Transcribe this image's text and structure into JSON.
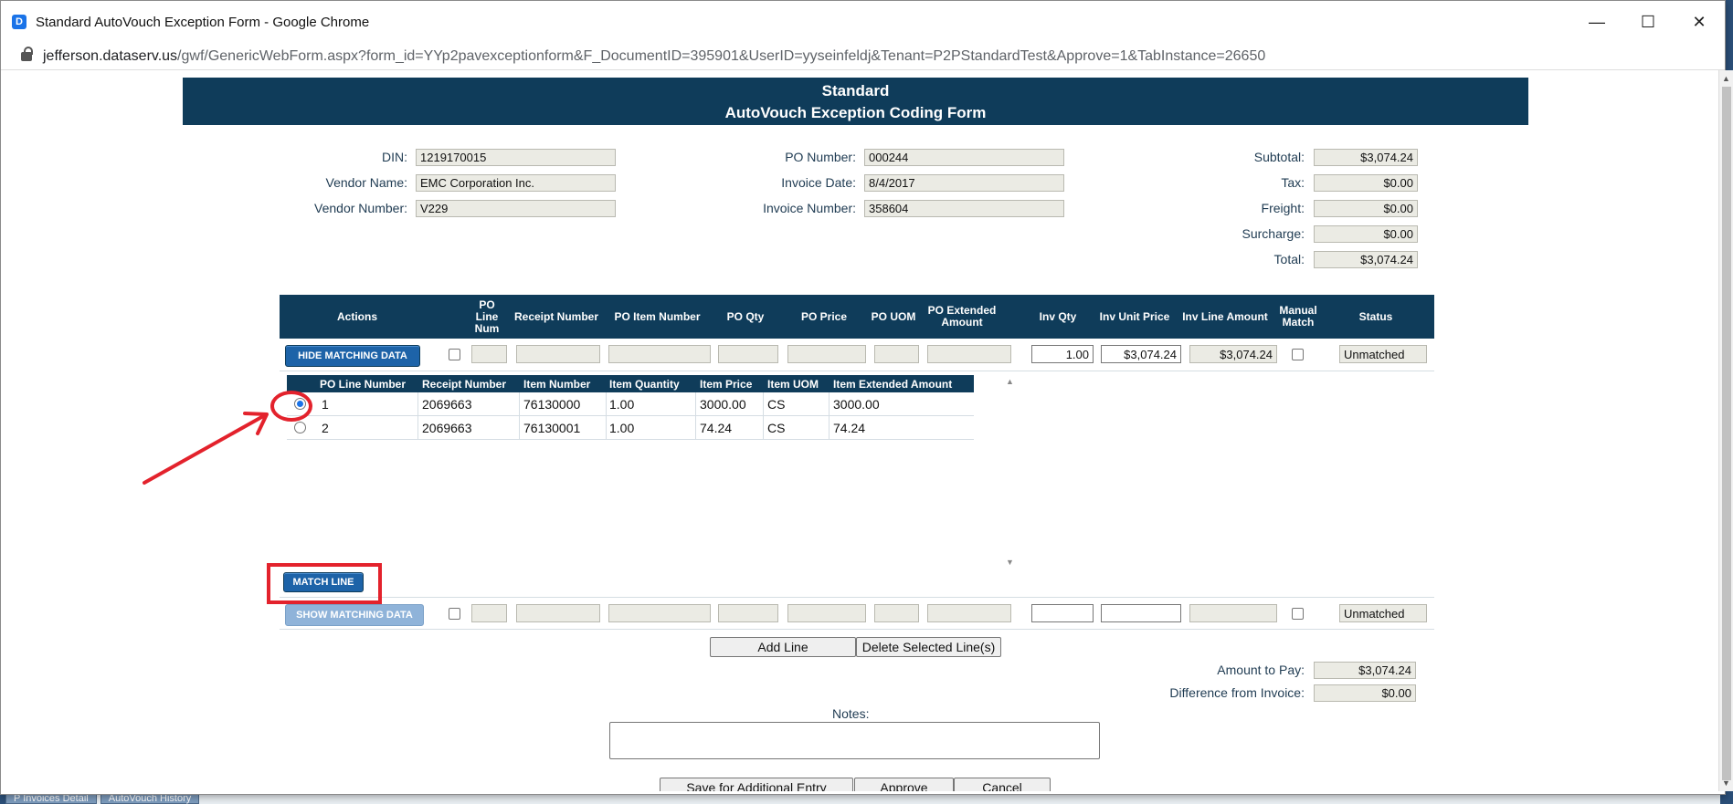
{
  "window": {
    "title": "Standard AutoVouch Exception Form - Google Chrome",
    "app_icon_letter": "D",
    "url_host": "jefferson.dataserv.us",
    "url_rest": "/gwf/GenericWebForm.aspx?form_id=YYp2pavexceptionform&F_DocumentID=395901&UserID=yyseinfeldj&Tenant=P2PStandardTest&Approve=1&TabInstance=26650",
    "minimize": "—",
    "maximize": "☐",
    "close": "✕"
  },
  "background_tabs": [
    "P Invoices Detail",
    "AutoVouch History"
  ],
  "form": {
    "title_line1": "Standard",
    "title_line2": "AutoVouch Exception Coding Form"
  },
  "header_fields": {
    "din_label": "DIN:",
    "din": "1219170015",
    "vendor_name_label": "Vendor Name:",
    "vendor_name": "EMC Corporation Inc.",
    "vendor_number_label": "Vendor Number:",
    "vendor_number": "V229",
    "po_number_label": "PO Number:",
    "po_number": "000244",
    "invoice_date_label": "Invoice Date:",
    "invoice_date": "8/4/2017",
    "invoice_number_label": "Invoice Number:",
    "invoice_number": "358604",
    "subtotal_label": "Subtotal:",
    "subtotal": "$3,074.24",
    "tax_label": "Tax:",
    "tax": "$0.00",
    "freight_label": "Freight:",
    "freight": "$0.00",
    "surcharge_label": "Surcharge:",
    "surcharge": "$0.00",
    "total_label": "Total:",
    "total": "$3,074.24"
  },
  "grid": {
    "headers": {
      "actions": "Actions",
      "po_line_num": "PO Line Num",
      "receipt_number": "Receipt Number",
      "po_item_number": "PO Item Number",
      "po_qty": "PO Qty",
      "po_price": "PO Price",
      "po_uom": "PO UOM",
      "po_extended_amount": "PO Extended Amount",
      "inv_qty": "Inv Qty",
      "inv_unit_price": "Inv Unit Price",
      "inv_line_amount": "Inv Line Amount",
      "manual_match": "Manual Match",
      "status": "Status"
    },
    "row1": {
      "action_label": "HIDE MATCHING DATA",
      "inv_qty": "1.00",
      "inv_unit_price": "$3,074.24",
      "inv_line_amount": "$3,074.24",
      "status": "Unmatched"
    },
    "row2": {
      "action_label": "SHOW MATCHING DATA",
      "inv_qty": "",
      "inv_unit_price": "",
      "inv_line_amount": "",
      "status": "Unmatched"
    }
  },
  "matching": {
    "headers": {
      "po_line_number": "PO Line Number",
      "receipt_number": "Receipt Number",
      "item_number": "Item Number",
      "item_quantity": "Item Quantity",
      "item_price": "Item Price",
      "item_uom": "Item UOM",
      "item_extended_amount": "Item Extended Amount"
    },
    "rows": [
      {
        "po_line_number": "1",
        "receipt_number": "2069663",
        "item_number": "76130000",
        "item_quantity": "1.00",
        "item_price": "3000.00",
        "item_uom": "CS",
        "item_extended_amount": "3000.00",
        "selected": true
      },
      {
        "po_line_number": "2",
        "receipt_number": "2069663",
        "item_number": "76130001",
        "item_quantity": "1.00",
        "item_price": "74.24",
        "item_uom": "CS",
        "item_extended_amount": "74.24",
        "selected": false
      }
    ],
    "match_button": "MATCH LINE"
  },
  "actions": {
    "add_line": "Add Line",
    "delete_lines": "Delete Selected Line(s)"
  },
  "totals": {
    "amount_to_pay_label": "Amount to Pay:",
    "amount_to_pay": "$3,074.24",
    "difference_label": "Difference from Invoice:",
    "difference": "$0.00"
  },
  "notes_label": "Notes:",
  "notes_value": "",
  "footer_buttons": {
    "save": "Save for Additional Entry",
    "approve": "Approve",
    "cancel": "Cancel"
  },
  "colors": {
    "header_navy": "#0f3c5a",
    "button_blue": "#1d63a8",
    "annotation_red": "#e3222c"
  }
}
